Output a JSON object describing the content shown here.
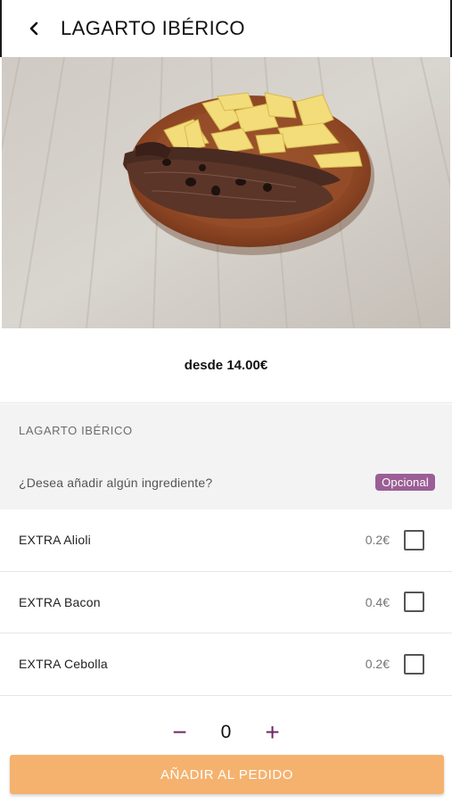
{
  "header": {
    "title": "LAGARTO IBÉRICO",
    "back_icon": "chevron-left-icon"
  },
  "price_label": "desde 14.00€",
  "section": {
    "title": "LAGARTO IBÉRICO",
    "question": "¿Desea añadir algún ingrediente?",
    "badge": "Opcional",
    "badge_color": "#9b5f95"
  },
  "options": [
    {
      "name": "EXTRA Alioli",
      "price": "0.2€"
    },
    {
      "name": "EXTRA Bacon",
      "price": "0.4€"
    },
    {
      "name": "EXTRA Cebolla",
      "price": "0.2€"
    }
  ],
  "quantity": {
    "value": "0",
    "minus": "−",
    "plus": "+"
  },
  "add_button": {
    "label": "AÑADIR AL PEDIDO",
    "color": "#f5b26e"
  }
}
